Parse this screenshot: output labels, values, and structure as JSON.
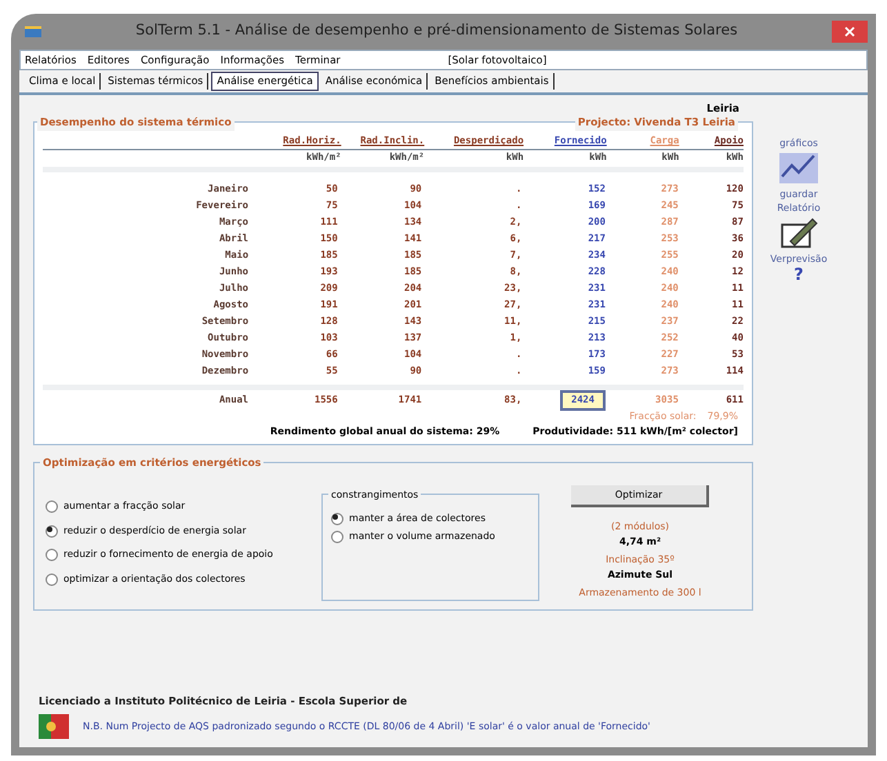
{
  "window": {
    "title": "SolTerm 5.1 - Análise de desempenho e pré-dimensionamento de Sistemas Solares"
  },
  "menu": [
    {
      "label": "Relatórios"
    },
    {
      "label": "Editores"
    },
    {
      "label": "Configuração"
    },
    {
      "label": "Informações"
    },
    {
      "label": "Terminar"
    }
  ],
  "menu_status": "[Solar fotovoltaico]",
  "tabs": [
    {
      "label": "Clima e local",
      "selected": false
    },
    {
      "label": "Sistemas térmicos",
      "selected": false
    },
    {
      "label": "Análise energética",
      "selected": true
    },
    {
      "label": "Análise económica",
      "selected": false
    },
    {
      "label": "Benefícios ambientais",
      "selected": false
    }
  ],
  "location": "Leiria",
  "performance": {
    "title": "Desempenho do sistema térmico",
    "project": "Projecto: Vivenda T3 Leiria",
    "columns": [
      {
        "label": "Rad.Horiz.",
        "unit": "kWh/m²",
        "color": "#8a3a22"
      },
      {
        "label": "Rad.Inclin.",
        "unit": "kWh/m²",
        "color": "#8a3a22"
      },
      {
        "label": "Desperdiçado",
        "unit": "kWh",
        "color": "#8a3a22"
      },
      {
        "label": "Fornecido",
        "unit": "kWh",
        "color": "#3848b0"
      },
      {
        "label": "Carga",
        "unit": "kWh",
        "color": "#e0906a"
      },
      {
        "label": "Apoio",
        "unit": "kWh",
        "color": "#6a2a22"
      }
    ],
    "rows": [
      {
        "month": "Janeiro",
        "values": [
          "50",
          "90",
          ".",
          "152",
          "273",
          "120"
        ]
      },
      {
        "month": "Fevereiro",
        "values": [
          "75",
          "104",
          ".",
          "169",
          "245",
          "75"
        ]
      },
      {
        "month": "Março",
        "values": [
          "111",
          "134",
          "2,",
          "200",
          "287",
          "87"
        ]
      },
      {
        "month": "Abril",
        "values": [
          "150",
          "141",
          "6,",
          "217",
          "253",
          "36"
        ]
      },
      {
        "month": "Maio",
        "values": [
          "185",
          "185",
          "7,",
          "234",
          "255",
          "20"
        ]
      },
      {
        "month": "Junho",
        "values": [
          "193",
          "185",
          "8,",
          "228",
          "240",
          "12"
        ]
      },
      {
        "month": "Julho",
        "values": [
          "209",
          "204",
          "23,",
          "231",
          "240",
          "11"
        ]
      },
      {
        "month": "Agosto",
        "values": [
          "191",
          "201",
          "27,",
          "231",
          "240",
          "11"
        ]
      },
      {
        "month": "Setembro",
        "values": [
          "128",
          "143",
          "11,",
          "215",
          "237",
          "22"
        ]
      },
      {
        "month": "Outubro",
        "values": [
          "103",
          "137",
          "1,",
          "213",
          "252",
          "40"
        ]
      },
      {
        "month": "Novembro",
        "values": [
          "66",
          "104",
          ".",
          "173",
          "227",
          "53"
        ]
      },
      {
        "month": "Dezembro",
        "values": [
          "55",
          "90",
          ".",
          "159",
          "273",
          "114"
        ]
      }
    ],
    "total": {
      "month": "Anual",
      "values": [
        "1556",
        "1741",
        "83,",
        "2424",
        "3035",
        "611"
      ]
    },
    "solar_fraction_label": "Fracção solar:",
    "solar_fraction": "79,9%",
    "efficiency": "Rendimento global anual do sistema: 29%",
    "productivity": "Produtividade: 511 kWh/[m² colector]"
  },
  "side_tools": [
    {
      "label": "gráficos",
      "kind": "chart"
    },
    {
      "label": "guardar Relatório",
      "kind": "save"
    },
    {
      "label": "Verprevisão",
      "kind": "help",
      "glyph": "?"
    }
  ],
  "optimization": {
    "title": "Optimização em critérios energéticos",
    "criteria": [
      {
        "label": "aumentar a fracção solar",
        "selected": false
      },
      {
        "label": "reduzir o desperdício de energia solar",
        "selected": true
      },
      {
        "label": "reduzir o fornecimento de energia de apoio",
        "selected": false
      },
      {
        "label": "optimizar a orientação dos colectores",
        "selected": false
      }
    ],
    "constraints_title": "constrangimentos",
    "constraints": [
      {
        "label": "manter a área de colectores",
        "selected": true
      },
      {
        "label": "manter o volume armazenado",
        "selected": false
      }
    ],
    "button": "Optimizar",
    "results": [
      {
        "text": "(2 módulos)",
        "kind": "note"
      },
      {
        "text": "4,74 m²",
        "kind": "value"
      },
      {
        "text": "Inclinação 35º",
        "kind": "note"
      },
      {
        "text": "Azimute Sul",
        "kind": "value"
      },
      {
        "text": "Armazenamento de 300 l",
        "kind": "note"
      }
    ]
  },
  "license": "Licenciado a Instituto Politécnico de Leiria - Escola Superior de",
  "note": "N.B. Num Projecto de AQS padronizado segundo o RCCTE (DL 80/06 de 4 Abril) 'E solar' é o valor anual de 'Fornecido'"
}
